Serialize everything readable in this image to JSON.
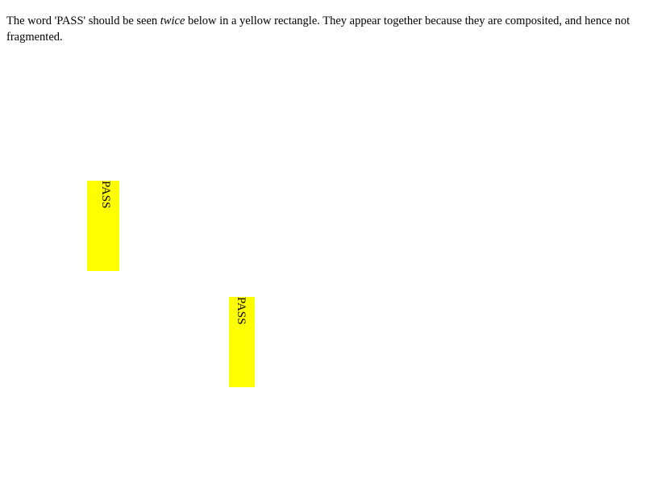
{
  "intro": {
    "before_emphasis": "The word 'PASS' should be seen ",
    "emphasis": "twice",
    "after_emphasis": " below in a yellow rectangle. They appear together because they are composited, and hence not fragmented."
  },
  "boxes": [
    {
      "text": "PASS"
    },
    {
      "text": "PASS"
    }
  ],
  "colors": {
    "background": "#ffffff",
    "box": "#ffff00",
    "text": "#000000"
  }
}
